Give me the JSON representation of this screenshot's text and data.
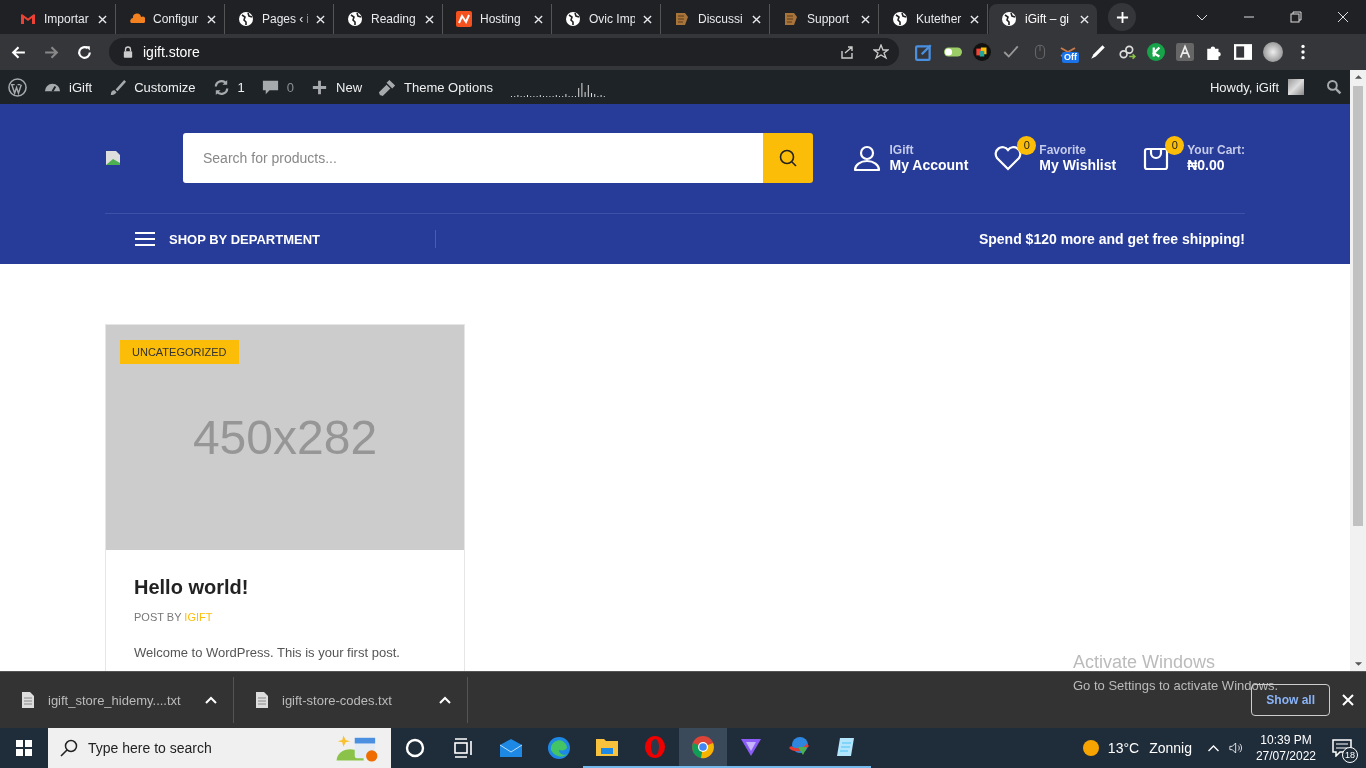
{
  "browser": {
    "tabs": [
      {
        "title": "Importar",
        "kind": "gmail",
        "selected": false
      },
      {
        "title": "Configur",
        "kind": "cloud",
        "selected": false
      },
      {
        "title": "Pages ‹ i",
        "kind": "globe",
        "selected": false
      },
      {
        "title": "Reading",
        "kind": "globe",
        "selected": false
      },
      {
        "title": "Hosting",
        "kind": "hosting",
        "selected": false
      },
      {
        "title": "Ovic Imp",
        "kind": "globe",
        "selected": false
      },
      {
        "title": "Discussi",
        "kind": "forum",
        "selected": false
      },
      {
        "title": "Support",
        "kind": "forum",
        "selected": false
      },
      {
        "title": "Kutether",
        "kind": "globe",
        "selected": false
      },
      {
        "title": "iGift – gi",
        "kind": "globe",
        "selected": true
      }
    ],
    "address": "igift.store",
    "extension_badge": "Off"
  },
  "admin_bar": {
    "site": "iGift",
    "customize": "Customize",
    "updates": "1",
    "comments": "0",
    "new": "New",
    "theme_options": "Theme Options",
    "greeting": "Howdy, iGift"
  },
  "header": {
    "search_placeholder": "Search for products...",
    "account": {
      "label": "IGift",
      "title": "My Account"
    },
    "wishlist": {
      "count": "0",
      "label": "Favorite",
      "title": "My Wishlist"
    },
    "cart": {
      "count": "0",
      "label": "Your Cart:",
      "total": "₦0.00"
    },
    "department": "SHOP BY DEPARTMENT",
    "promo": "Spend $120 more and get free shipping!"
  },
  "posts": [
    {
      "category": "UNCATEGORIZED",
      "image": "450x282",
      "title": "Hello world!",
      "byline": "POST BY",
      "author": "IGIFT",
      "excerpt": "Welcome to WordPress. This is your first post."
    }
  ],
  "downloads": [
    {
      "name": "igift_store_hidemy....txt"
    },
    {
      "name": "igift-store-codes.txt"
    }
  ],
  "show_all": "Show all",
  "activation": {
    "title": "Activate Windows",
    "text": "Go to Settings to activate Windows."
  },
  "taskbar": {
    "search_placeholder": "Type here to search",
    "apps": [
      {
        "kind": "cortana",
        "running": false,
        "selected": false
      },
      {
        "kind": "taskview",
        "running": false,
        "selected": false
      },
      {
        "kind": "mail",
        "running": false,
        "selected": false
      },
      {
        "kind": "edge",
        "running": false,
        "selected": false
      },
      {
        "kind": "explorer",
        "running": true,
        "selected": false
      },
      {
        "kind": "opera",
        "running": true,
        "selected": false
      },
      {
        "kind": "chrome",
        "running": true,
        "selected": true
      },
      {
        "kind": "vpn",
        "running": true,
        "selected": false
      },
      {
        "kind": "download",
        "running": true,
        "selected": false
      },
      {
        "kind": "notepad",
        "running": true,
        "selected": false
      }
    ],
    "temperature": "13°C",
    "condition": "Zonnig",
    "time": "10:39 PM",
    "date": "27/07/2022",
    "notifications": "18"
  }
}
